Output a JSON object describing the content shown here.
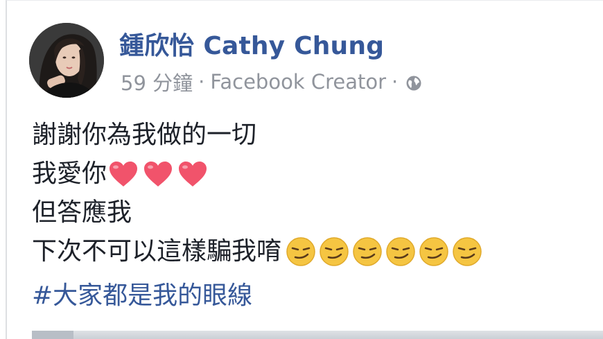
{
  "post": {
    "author": "鍾欣怡 Cathy Chung",
    "time": "59 分鐘",
    "separator": "·",
    "source": "Facebook Creator",
    "privacy_icon": "globe-icon",
    "lines": [
      "謝謝你為我做的一切",
      "我愛你",
      "但答應我",
      "下次不可以這樣騙我唷"
    ],
    "hashtag": "#大家都是我的眼線",
    "emojis": {
      "hearts": 3,
      "heart_icon": "red-heart-icon",
      "smirks": 6,
      "smirk_icon": "smirking-face-icon"
    }
  },
  "colors": {
    "link": "#365899",
    "meta": "#90949c",
    "text": "#1d2129",
    "heart": "#f1536b",
    "emoji_face": "#f5c542"
  }
}
